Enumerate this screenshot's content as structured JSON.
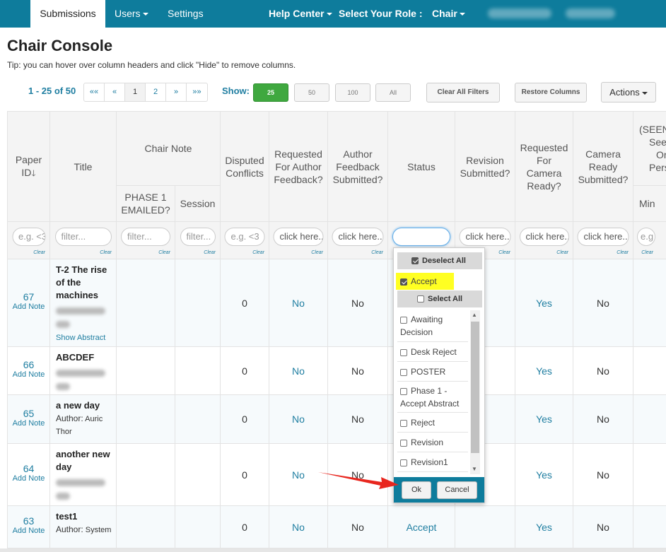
{
  "nav": {
    "submissions": "Submissions",
    "users": "Users",
    "settings": "Settings",
    "help_center": "Help Center",
    "select_role": "Select Your Role :",
    "role": "Chair"
  },
  "page": {
    "title": "Chair Console",
    "tip": "Tip: you can hover over column headers and click \"Hide\" to remove columns."
  },
  "pagination": {
    "range": "1 - 25 of 50",
    "first": "««",
    "prev": "«",
    "page1": "1",
    "page2": "2",
    "next": "»",
    "last": "»»",
    "show_label": "Show:",
    "sizes": [
      "25",
      "50",
      "100",
      "All"
    ],
    "clear_filters": "Clear All Filters",
    "restore_columns": "Restore Columns",
    "actions": "Actions"
  },
  "columns": {
    "paper_id": "Paper ID",
    "title": "Title",
    "chair_note": "Chair Note",
    "phase1_emailed": "PHASE 1 EMAILED?",
    "session": "Session",
    "disputed": "Disputed Conflicts",
    "req_author_fb": "Requested For Author Feedback?",
    "author_fb_sub": "Author Feedback Submitted?",
    "status": "Status",
    "revision_sub": "Revision Submitted?",
    "req_camera": "Requested For Camera Ready?",
    "camera_sub": "Camera Ready Submitted?",
    "seen_l1": "(SEEN",
    "seen_l2": "See",
    "seen_l3": "Or",
    "seen_l4": "Perso",
    "min": "Min"
  },
  "filters": {
    "paper_id": "e.g. <3",
    "title": "filter...",
    "phase1": "filter...",
    "session": "filter...",
    "disputed": "e.g. <3",
    "click_here": "click here...",
    "last": "e.g",
    "clear": "Clear"
  },
  "status_dropdown": {
    "deselect_all": "Deselect All",
    "accept": "Accept",
    "select_all": "Select All",
    "options": [
      "Awaiting Decision",
      "Desk Reject",
      "POSTER",
      "Phase 1 - Accept Abstract",
      "Reject",
      "Revision",
      "Revision1"
    ],
    "ok": "Ok",
    "cancel": "Cancel"
  },
  "rows": [
    {
      "id": "67",
      "add_note": "Add Note",
      "title_l1": "T-2 The rise",
      "title_l2": "of the",
      "title_l3": "machines",
      "show_abstract": "Show Abstract",
      "disputed": "0",
      "req_fb": "No",
      "fb_sub": "No",
      "req_camera": "Yes",
      "camera_sub": "No"
    },
    {
      "id": "66",
      "add_note": "Add Note",
      "title_l1": "ABCDEF",
      "disputed": "0",
      "req_fb": "No",
      "fb_sub": "No",
      "req_camera": "Yes",
      "camera_sub": "No"
    },
    {
      "id": "65",
      "add_note": "Add Note",
      "title_l1": "a new day",
      "author_label": "Author:",
      "author_l1": "Auric",
      "author_l2": "Thor",
      "disputed": "0",
      "req_fb": "No",
      "fb_sub": "No",
      "req_camera": "Yes",
      "camera_sub": "No"
    },
    {
      "id": "64",
      "add_note": "Add Note",
      "title_l1": "another new",
      "title_l2": "day",
      "disputed": "0",
      "req_fb": "No",
      "fb_sub": "No",
      "req_camera": "Yes",
      "camera_sub": "No"
    },
    {
      "id": "63",
      "add_note": "Add Note",
      "title_l1": "test1",
      "author_label": "Author:",
      "author_l1": "System",
      "disputed": "0",
      "req_fb": "No",
      "fb_sub": "No",
      "status": "Accept",
      "req_camera": "Yes",
      "camera_sub": "No"
    }
  ],
  "colors": {
    "nav_bg": "#0e7c9c",
    "link": "#1f7ea1",
    "green": "#3fa83f",
    "highlight": "#ffff22",
    "arrow": "#e8261e"
  }
}
